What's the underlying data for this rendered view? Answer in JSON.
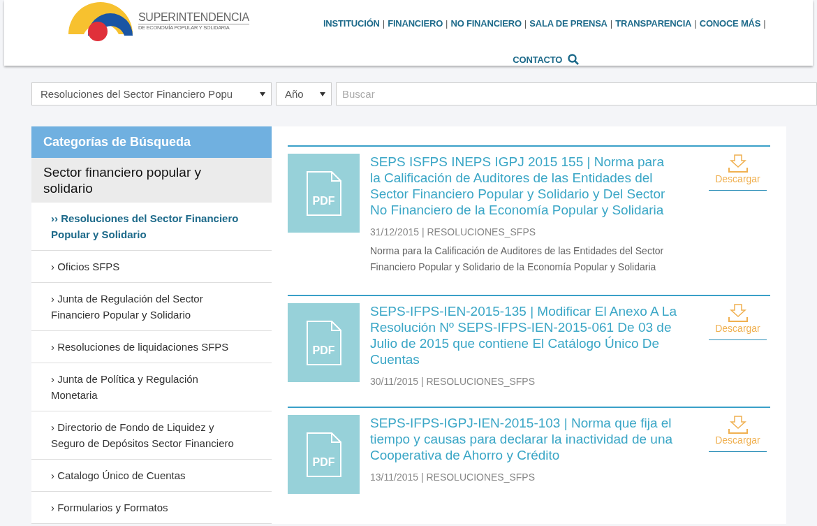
{
  "header": {
    "logo": {
      "name": "SUPERINTENDENCIA",
      "subtitle": "DE ECONOMÍA POPULAR Y SOLIDARIA"
    },
    "nav": [
      "INSTITUCIÓN",
      "FINANCIERO",
      "NO FINANCIERO",
      "SALA DE PRENSA",
      "TRANSPARENCIA",
      "CONOCE MÁS",
      "CONTACTO"
    ],
    "separator": "|"
  },
  "filters": {
    "category": "Resoluciones del Sector Financiero Popu",
    "year": "Año",
    "search": {
      "placeholder": "Buscar"
    }
  },
  "sidebar": {
    "title": "Categorías de Búsqueda",
    "section": "Sector financiero popular y solidario",
    "items": [
      {
        "marker": "››",
        "label": "Resoluciones del Sector Financiero Popular y Solidario",
        "selected": true
      },
      {
        "marker": "›",
        "label": "Oficios SFPS",
        "selected": false
      },
      {
        "marker": "›",
        "label": "Junta de Regulación del Sector Financiero Popular y Solidario",
        "selected": false
      },
      {
        "marker": "›",
        "label": "Resoluciones de liquidaciones SFPS",
        "selected": false
      },
      {
        "marker": "›",
        "label": "Junta de Política y Regulación Monetaria",
        "selected": false
      },
      {
        "marker": "›",
        "label": "Directorio de Fondo de Liquidez y Seguro de Depósitos Sector Financiero",
        "selected": false
      },
      {
        "marker": "›",
        "label": "Catalogo Único de Cuentas",
        "selected": false
      },
      {
        "marker": "›",
        "label": "Formularios y Formatos",
        "selected": false
      }
    ]
  },
  "results": [
    {
      "thumb": "PDF",
      "title": "SEPS ISFPS INEPS IGPJ 2015 155 | Norma para la Calificación de Auditores de las Entidades del Sector Financiero Popular y Solidario y Del Sector No Financiero de la Economía Popular y Solidaria",
      "meta": "31/12/2015 | RESOLUCIONES_SFPS",
      "description": "Norma para la Calificación de Auditores de las Entidades del Sector Financiero Popular y Solidario de la Economía Popular y Solidaria",
      "download": "Descargar"
    },
    {
      "thumb": "PDF",
      "title": "SEPS-IFPS-IEN-2015-135 | Modificar El Anexo A La Resolución Nº SEPS-IFPS-IEN-2015-061 De 03 de Julio de 2015 que contiene El Catálogo Único De Cuentas",
      "meta": "30/11/2015 | RESOLUCIONES_SFPS",
      "download": "Descargar"
    },
    {
      "thumb": "PDF",
      "title": "SEPS-IFPS-IGPJ-IEN-2015-103 | Norma que fija el tiempo y causas para declarar la inactividad de una Cooperativa de Ahorro y Crédito",
      "meta": "13/11/2015 | RESOLUCIONES_SFPS",
      "download": "Descargar"
    }
  ]
}
